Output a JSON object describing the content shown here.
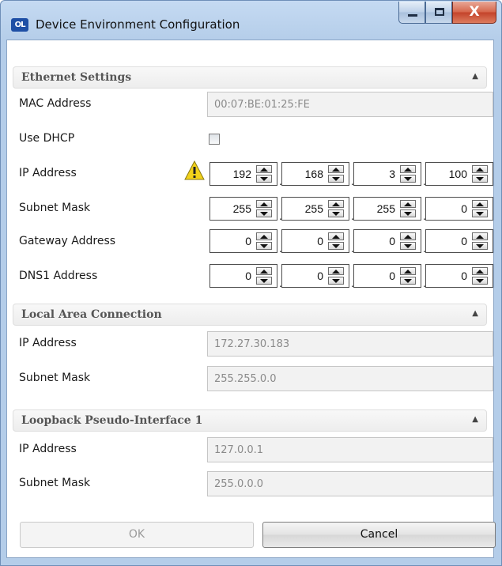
{
  "window": {
    "title": "Device Environment Configuration",
    "app_icon_text": "OL",
    "close_glyph": "X"
  },
  "ethernet": {
    "header": "Ethernet Settings",
    "mac_label": "MAC Address",
    "mac_value": "00:07:BE:01:25:FE",
    "dhcp_label": "Use DHCP",
    "dhcp_checked": false,
    "ip_label": "IP Address",
    "ip_octets": [
      "192",
      "168",
      "3",
      "100"
    ],
    "subnet_label": "Subnet Mask",
    "subnet_octets": [
      "255",
      "255",
      "255",
      "0"
    ],
    "gateway_label": "Gateway Address",
    "gateway_octets": [
      "0",
      "0",
      "0",
      "0"
    ],
    "dns1_label": "DNS1 Address",
    "dns1_octets": [
      "0",
      "0",
      "0",
      "0"
    ],
    "warning_icon": "warning-triangle"
  },
  "local_area": {
    "header": "Local Area Connection",
    "ip_label": "IP Address",
    "ip_value": "172.27.30.183",
    "subnet_label": "Subnet Mask",
    "subnet_value": "255.255.0.0"
  },
  "loopback": {
    "header": "Loopback Pseudo-Interface 1",
    "ip_label": "IP Address",
    "ip_value": "127.0.0.1",
    "subnet_label": "Subnet Mask",
    "subnet_value": "255.0.0.0"
  },
  "buttons": {
    "ok": "OK",
    "cancel": "Cancel"
  },
  "colors": {
    "title_frame": "#b4cde9",
    "section_header_bg": "#efefef",
    "disabled_text": "#9a9a9a",
    "warning": "#f2d21b"
  }
}
